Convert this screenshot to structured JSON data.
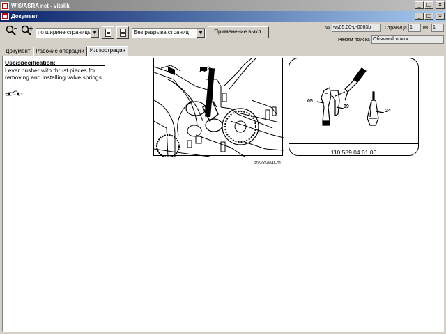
{
  "app": {
    "title": "WIS/ASRA net - vitalik",
    "inner_title": "Документ"
  },
  "toolbar": {
    "zoom_select_value": "по ширине страницы",
    "page_mode_select_value": "Без разрыва страниц",
    "apply_button_label": "Применение выкл.",
    "doc_number_label": "№",
    "doc_number_value": "ws05.00-p-0063b",
    "page_label": "Страница",
    "page_value": "1",
    "of_label": "из",
    "of_value": "1",
    "search_mode_label": "Режим поиска",
    "search_mode_value": "Обычный поиск"
  },
  "tabs": [
    {
      "label": "Документ"
    },
    {
      "label": "Рабочие операции"
    },
    {
      "label": "Иллюстрация"
    }
  ],
  "content": {
    "spec_title": "Use/specification:",
    "spec_text": "Lever pusher with thrust pieces for removing and installing valve springs",
    "figure_code": "P05.00-0046-01",
    "part_number": "110 589 04 61 00",
    "callouts": [
      "05",
      "09",
      "24"
    ]
  },
  "icons": [
    "app-icon",
    "zoom-out-icon",
    "zoom-in-icon",
    "document-icon",
    "document-list-icon",
    "minimize-icon",
    "maximize-icon",
    "close-icon"
  ]
}
